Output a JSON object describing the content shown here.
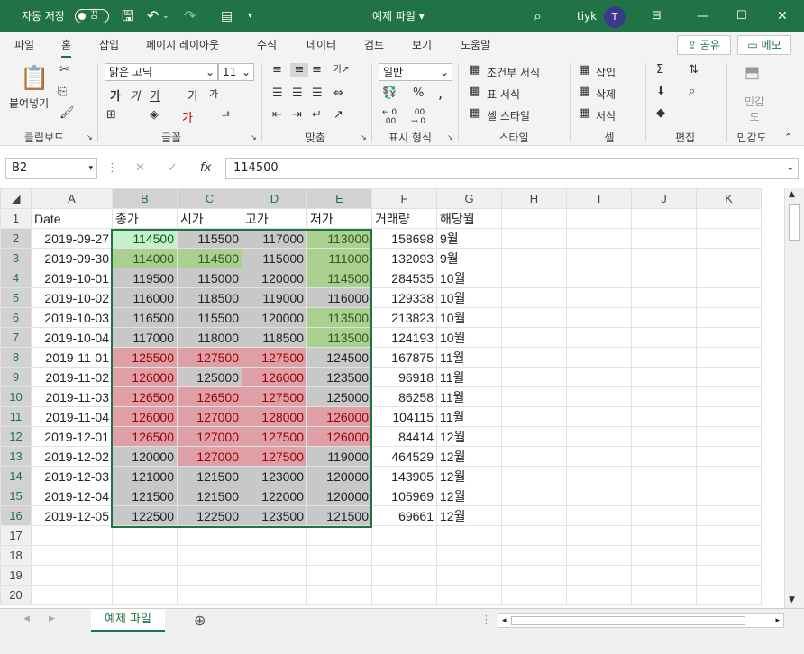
{
  "title_bar": {
    "autosave_label": "자동 저장",
    "autosave_state": "끔",
    "file_title": "예제 파일 ▾",
    "user_name": "tiyk",
    "avatar_letter": "T"
  },
  "menu": {
    "tabs": [
      "파일",
      "홈",
      "삽입",
      "페이지 레이아웃",
      "수식",
      "데이터",
      "검토",
      "보기",
      "도움말"
    ],
    "active_tab": "홈",
    "share_label": "공유",
    "memo_label": "메모"
  },
  "ribbon": {
    "clipboard": {
      "paste": "붙여넣기",
      "label": "클립보드"
    },
    "font": {
      "name": "맑은 고딕",
      "size": "11",
      "label": "글꼴"
    },
    "alignment": {
      "label": "맞춤"
    },
    "number": {
      "format": "일반",
      "label": "표시 형식"
    },
    "styles": {
      "conditional": "조건부 서식",
      "table": "표 서식",
      "cell": "셀 스타일",
      "label": "스타일"
    },
    "cells": {
      "insert": "삽입",
      "delete": "삭제",
      "format": "서식",
      "label": "셀"
    },
    "editing": {
      "label": "편집"
    },
    "sensitivity": {
      "button": "민감도",
      "label": "민감도"
    }
  },
  "formula_bar": {
    "name_box": "B2",
    "fx": "fx",
    "value": "114500"
  },
  "columns": [
    "A",
    "B",
    "C",
    "D",
    "E",
    "F",
    "G",
    "H",
    "I",
    "J",
    "K"
  ],
  "header_row": [
    "Date",
    "종가",
    "시가",
    "고가",
    "저가",
    "거래량",
    "해당월"
  ],
  "rows": [
    {
      "date": "2019-09-27",
      "close": "114500",
      "open": "115500",
      "high": "117000",
      "low": "113000",
      "volume": "158698",
      "month": "9월"
    },
    {
      "date": "2019-09-30",
      "close": "114000",
      "open": "114500",
      "high": "115000",
      "low": "111000",
      "volume": "132093",
      "month": "9월"
    },
    {
      "date": "2019-10-01",
      "close": "119500",
      "open": "115000",
      "high": "120000",
      "low": "114500",
      "volume": "284535",
      "month": "10월"
    },
    {
      "date": "2019-10-02",
      "close": "116000",
      "open": "118500",
      "high": "119000",
      "low": "116000",
      "volume": "129338",
      "month": "10월"
    },
    {
      "date": "2019-10-03",
      "close": "116500",
      "open": "115500",
      "high": "120000",
      "low": "113500",
      "volume": "213823",
      "month": "10월"
    },
    {
      "date": "2019-10-04",
      "close": "117000",
      "open": "118000",
      "high": "118500",
      "low": "113500",
      "volume": "124193",
      "month": "10월"
    },
    {
      "date": "2019-11-01",
      "close": "125500",
      "open": "127500",
      "high": "127500",
      "low": "124500",
      "volume": "167875",
      "month": "11월"
    },
    {
      "date": "2019-11-02",
      "close": "126000",
      "open": "125000",
      "high": "126000",
      "low": "123500",
      "volume": "96918",
      "month": "11월"
    },
    {
      "date": "2019-11-03",
      "close": "126500",
      "open": "126500",
      "high": "127500",
      "low": "125000",
      "volume": "86258",
      "month": "11월"
    },
    {
      "date": "2019-11-04",
      "close": "126000",
      "open": "127000",
      "high": "128000",
      "low": "126000",
      "volume": "104115",
      "month": "11월"
    },
    {
      "date": "2019-12-01",
      "close": "126500",
      "open": "127000",
      "high": "127500",
      "low": "126000",
      "volume": "84414",
      "month": "12월"
    },
    {
      "date": "2019-12-02",
      "close": "120000",
      "open": "127000",
      "high": "127500",
      "low": "119000",
      "volume": "464529",
      "month": "12월"
    },
    {
      "date": "2019-12-03",
      "close": "121000",
      "open": "121500",
      "high": "123000",
      "low": "120000",
      "volume": "143905",
      "month": "12월"
    },
    {
      "date": "2019-12-04",
      "close": "121500",
      "open": "121500",
      "high": "122000",
      "low": "120000",
      "volume": "105969",
      "month": "12월"
    },
    {
      "date": "2019-12-05",
      "close": "122500",
      "open": "122500",
      "high": "123500",
      "low": "121500",
      "volume": "69661",
      "month": "12월"
    }
  ],
  "cell_fills": [
    [
      "g-light",
      "gy",
      "gy",
      "g"
    ],
    [
      "g",
      "g",
      "gy",
      "g"
    ],
    [
      "gy",
      "gy",
      "gy",
      "g"
    ],
    [
      "gy",
      "gy",
      "gy",
      "gy"
    ],
    [
      "gy",
      "gy",
      "gy",
      "g"
    ],
    [
      "gy",
      "gy",
      "gy",
      "g"
    ],
    [
      "r",
      "r",
      "r",
      "gy"
    ],
    [
      "r",
      "gy",
      "r",
      "gy"
    ],
    [
      "r",
      "r",
      "r",
      "gy"
    ],
    [
      "r",
      "r",
      "r",
      "r"
    ],
    [
      "r",
      "r",
      "r",
      "r"
    ],
    [
      "gy",
      "r",
      "r",
      "gy"
    ],
    [
      "gy",
      "gy",
      "gy",
      "gy"
    ],
    [
      "gy",
      "gy",
      "gy",
      "gy"
    ],
    [
      "gy",
      "gy",
      "gy",
      "gy"
    ]
  ],
  "empty_rows": [
    "17",
    "18",
    "19",
    "20"
  ],
  "sheet": {
    "tab_name": "예제 파일"
  },
  "colors": {
    "accent": "#217346"
  }
}
